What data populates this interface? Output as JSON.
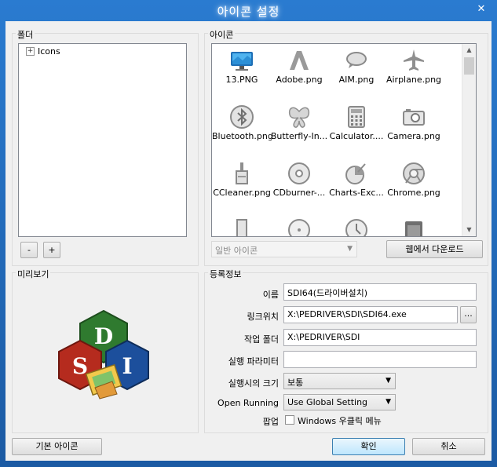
{
  "window": {
    "title": "아이콘 설정",
    "close_symbol": "✕"
  },
  "folder": {
    "group_label": "폴더",
    "tree": {
      "expander": "+",
      "root_label": "Icons"
    },
    "remove_label": "-",
    "add_label": "+"
  },
  "icons": {
    "group_label": "아이콘",
    "items": [
      {
        "label": "13.PNG",
        "icon": "monitor-icon"
      },
      {
        "label": "Adobe.png",
        "icon": "adobe-icon"
      },
      {
        "label": "AIM.png",
        "icon": "aim-icon"
      },
      {
        "label": "Airplane.png",
        "icon": "airplane-icon"
      },
      {
        "label": "Bluetooth.png",
        "icon": "bluetooth-icon"
      },
      {
        "label": "Butterfly-In...",
        "icon": "butterfly-icon"
      },
      {
        "label": "Calculator....",
        "icon": "calculator-icon"
      },
      {
        "label": "Camera.png",
        "icon": "camera-icon"
      },
      {
        "label": "CCleaner.png",
        "icon": "ccleaner-icon"
      },
      {
        "label": "CDburner-...",
        "icon": "cd-icon"
      },
      {
        "label": "Charts-Exc...",
        "icon": "charts-icon"
      },
      {
        "label": "Chrome.png",
        "icon": "chrome-icon"
      }
    ],
    "category_select": "일반 아이콘",
    "download_label": "웹에서 다운로드"
  },
  "preview": {
    "group_label": "미리보기"
  },
  "registration": {
    "group_label": "등록정보",
    "name_label": "이름",
    "name_value": "SDI64(드라이버설치)",
    "link_label": "링크위치",
    "link_value": "X:\\PEDRIVER\\SDI\\SDI64.exe",
    "browse_label": "...",
    "workdir_label": "작업 폴더",
    "workdir_value": "X:\\PEDRIVER\\SDI",
    "params_label": "실행 파라미터",
    "params_value": "",
    "size_label": "실행시의 크기",
    "size_value": "보통",
    "openrun_label": "Open Running",
    "openrun_value": "Use Global Setting",
    "popup_label": "팝업",
    "popup_check_label": "Windows 우클릭 메뉴"
  },
  "footer": {
    "default_icon_label": "기본 아이콘",
    "ok_label": "확인",
    "cancel_label": "취소"
  }
}
